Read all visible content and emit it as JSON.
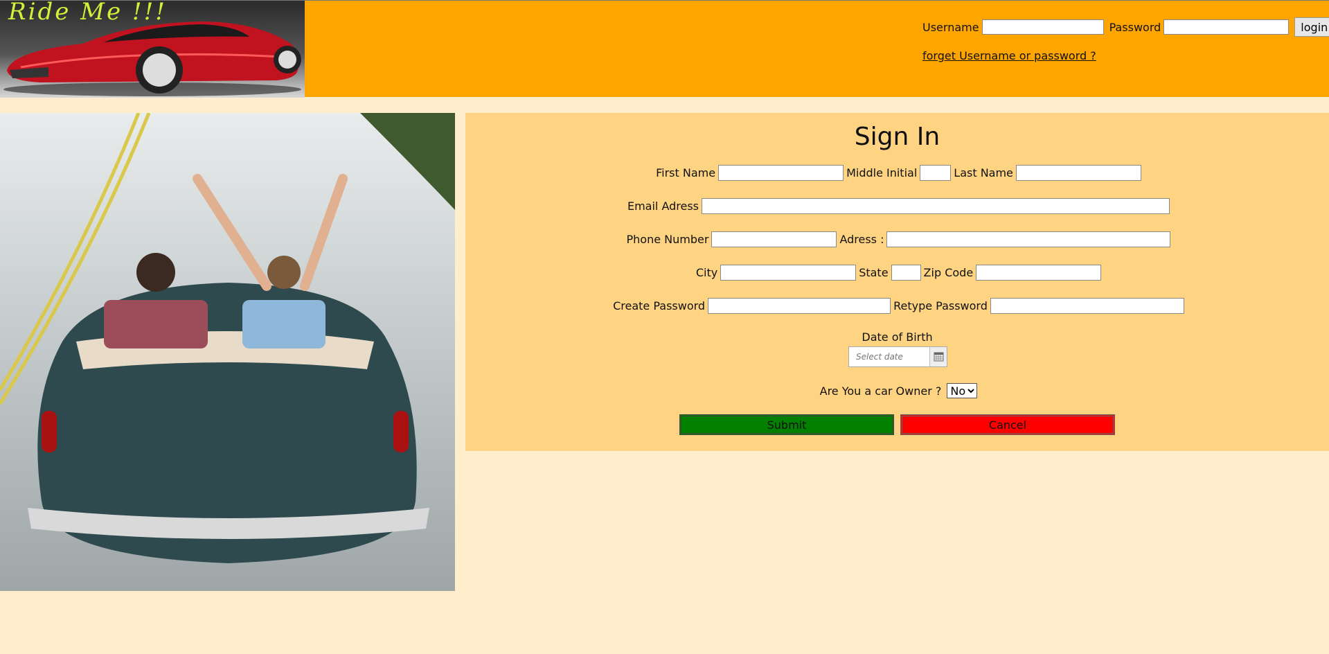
{
  "header": {
    "logo_text": "Ride Me !!!",
    "username_label": "Username",
    "password_label": "Password",
    "login_label": "login",
    "forget_link": "forget Username or password ?"
  },
  "form": {
    "title": "Sign In",
    "first_name_label": "First Name",
    "middle_initial_label": "Middle Initial",
    "last_name_label": "Last Name",
    "email_label": "Email Adress",
    "phone_label": "Phone Number",
    "address_label": "Adress :",
    "city_label": "City",
    "state_label": "State",
    "zip_label": "Zip Code",
    "create_password_label": "Create Password",
    "retype_password_label": "Retype Password",
    "dob_label": "Date of Birth",
    "dob_placeholder": "Select date",
    "owner_label": "Are You a car Owner ?",
    "owner_selected": "No",
    "submit_label": "Submit",
    "cancel_label": "Cancel"
  },
  "colors": {
    "header_bg": "#ffa500",
    "page_bg": "#ffedcc",
    "panel_bg": "#fed382",
    "submit_bg": "#038000",
    "cancel_bg": "#fe0000"
  }
}
